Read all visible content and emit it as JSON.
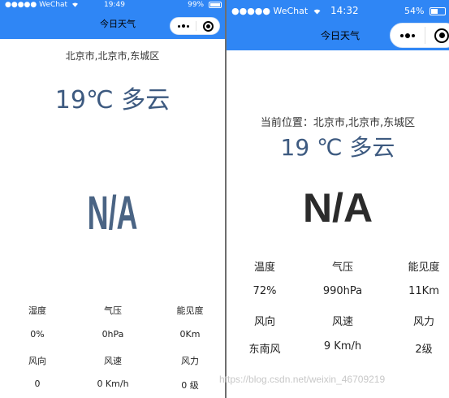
{
  "left": {
    "status": {
      "carrier": "●●●●● WeChat",
      "time": "19:49",
      "battery": "99%",
      "battery_level": 0.99
    },
    "nav": {
      "title": "今日天气"
    },
    "location": "北京市,北京市,东城区",
    "weather": "19℃ 多云",
    "icon_text": "N/A",
    "details": {
      "humidity_label": "湿度",
      "humidity": "0%",
      "pressure_label": "气压",
      "pressure": "0hPa",
      "visibility_label": "能见度",
      "visibility": "0Km",
      "wind_dir_label": "风向",
      "wind_dir": "0",
      "wind_speed_label": "风速",
      "wind_speed": "0 Km/h",
      "wind_power_label": "风力",
      "wind_power": "0 级"
    }
  },
  "right": {
    "status": {
      "carrier": "●●●●● WeChat",
      "time": "14:32",
      "battery": "54%",
      "battery_level": 0.54
    },
    "nav": {
      "title": "今日天气"
    },
    "location": "当前位置：北京市,北京市,东城区",
    "weather": "19 ℃ 多云",
    "icon_text": "N/A",
    "details": {
      "humidity_label": "温度",
      "humidity": "72%",
      "pressure_label": "气压",
      "pressure": "990hPa",
      "visibility_label": "能见度",
      "visibility": "11Km",
      "wind_dir_label": "风向",
      "wind_dir": "东南风",
      "wind_speed_label": "风速",
      "wind_speed": "9 Km/h",
      "wind_power_label": "风力",
      "wind_power": "2级"
    }
  },
  "watermark": "https://blog.csdn.net/weixin_46709219",
  "colors": {
    "nav_bg": "#2f86f5",
    "weather_text": "#3d5a80",
    "na_left": "#4a6484",
    "na_right": "#2b2b2b"
  }
}
